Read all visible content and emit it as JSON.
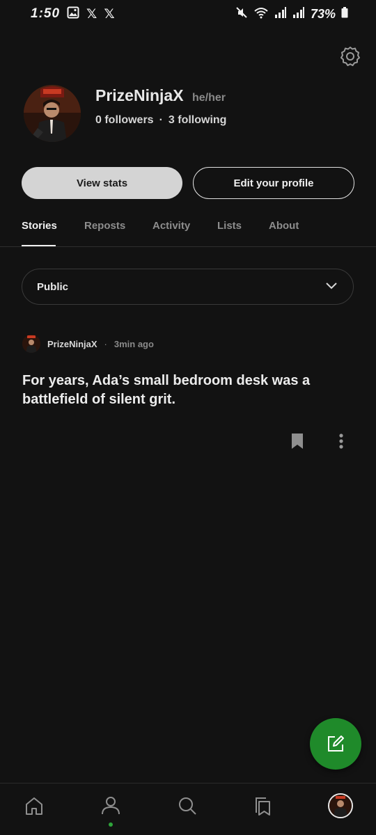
{
  "status_bar": {
    "time": "1:50",
    "battery": "73%",
    "icons": [
      "gallery-icon",
      "x-logo-icon",
      "x-logo-icon",
      "mute-icon",
      "wifi-icon",
      "signal-icon",
      "signal-icon",
      "battery-icon"
    ]
  },
  "profile": {
    "name": "PrizeNinjaX",
    "pronouns": "he/her",
    "followers": "0 followers",
    "separator": "·",
    "following": "3 following"
  },
  "actions": {
    "view_stats": "View stats",
    "edit_profile": "Edit your profile"
  },
  "tabs": [
    {
      "label": "Stories",
      "active": true
    },
    {
      "label": "Reposts",
      "active": false
    },
    {
      "label": "Activity",
      "active": false
    },
    {
      "label": "Lists",
      "active": false
    },
    {
      "label": "About",
      "active": false
    }
  ],
  "filter": {
    "selected": "Public"
  },
  "story": {
    "author": "PrizeNinjaX",
    "separator": "·",
    "time": "3min ago",
    "title": "For years, Ada’s small bedroom desk was a battlefield of silent grit."
  },
  "bottom_nav": {
    "items": [
      "home-icon",
      "profile-icon",
      "search-icon",
      "library-icon",
      "avatar"
    ],
    "active": "profile-icon"
  },
  "colors": {
    "background": "#121212",
    "accent_green": "#1f8a2a",
    "active_dot": "#2ea43a"
  }
}
